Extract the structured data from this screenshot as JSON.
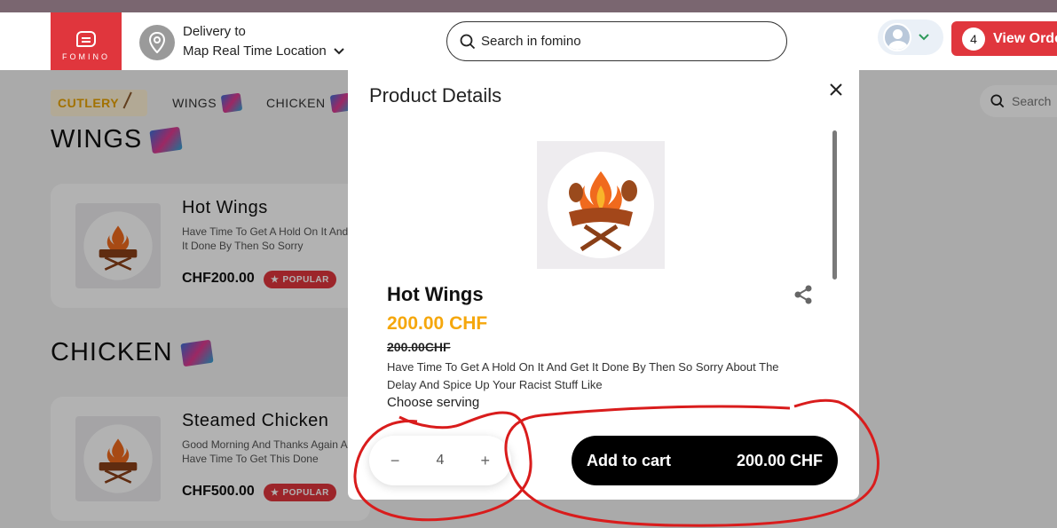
{
  "header": {
    "logo_text": "FOMINO",
    "delivery_label": "Delivery to",
    "delivery_location": "Map Real Time Location",
    "search_placeholder": "Search in fomino",
    "order_count": "4",
    "view_order_label": "View Orde"
  },
  "background": {
    "categories": [
      {
        "label": "CUTLERY"
      },
      {
        "label": "WINGS"
      },
      {
        "label": "CHICKEN"
      }
    ],
    "search_placeholder": "Search",
    "sections": [
      {
        "title": "WINGS",
        "item": {
          "name": "Hot Wings",
          "description": "Have Time To Get A Hold On It And Get It Done By Then So Sorry",
          "price": "CHF200.00",
          "badge": "POPULAR"
        }
      },
      {
        "title": "CHICKEN",
        "item": {
          "name": "Steamed Chicken",
          "description": "Good Morning And Thanks Again And Have Time To Get This Done",
          "price": "CHF500.00",
          "badge": "POPULAR"
        }
      }
    ]
  },
  "modal": {
    "title": "Product Details",
    "product_name": "Hot Wings",
    "price": "200.00 CHF",
    "old_price": "200.00CHF",
    "description": "Have Time To Get A Hold On It And Get It Done By Then So Sorry About The Delay And Spice Up Your Racist Stuff Like",
    "choose_label": "Choose serving",
    "quantity": "4",
    "add_to_cart_label": "Add to cart",
    "add_to_cart_price": "200.00 CHF"
  },
  "colors": {
    "brand_red": "#e0363d",
    "price_orange": "#f5a70c",
    "annotation_red": "#d91c1c"
  }
}
